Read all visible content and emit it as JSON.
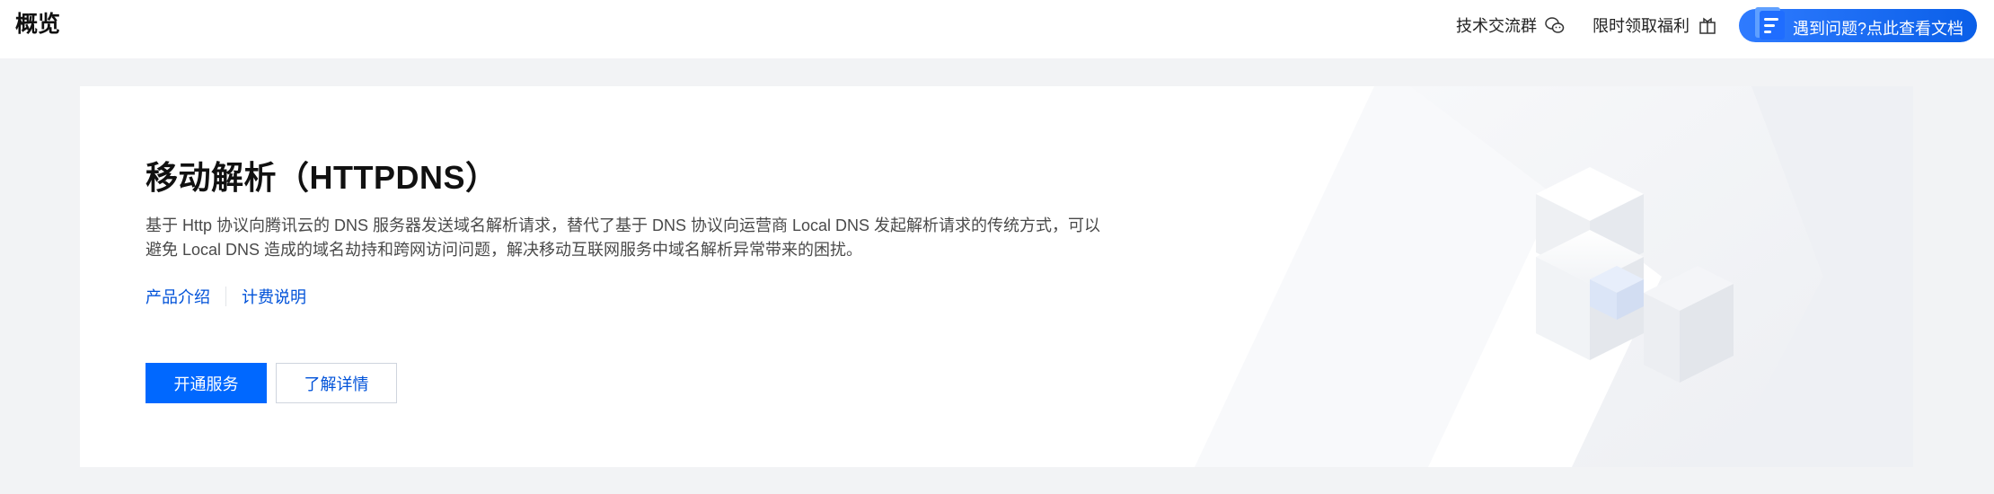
{
  "header": {
    "title": "概览",
    "links": [
      {
        "label": "技术交流群",
        "icon": "wechat-icon"
      },
      {
        "label": "限时领取福利",
        "icon": "gift-icon"
      }
    ],
    "help": {
      "label": "遇到问题?点此查看文档",
      "icon": "document-icon"
    }
  },
  "product": {
    "title": "移动解析（HTTPDNS）",
    "description": "基于 Http 协议向腾讯云的 DNS 服务器发送域名解析请求，替代了基于 DNS 协议向运营商 Local DNS 发起解析请求的传统方式，可以避免 Local DNS 造成的域名劫持和跨网访问问题，解决移动互联网服务中域名解析异常带来的困扰。",
    "links": [
      {
        "label": "产品介绍"
      },
      {
        "label": "计费说明"
      }
    ],
    "primary_button": "开通服务",
    "secondary_button": "了解详情"
  },
  "colors": {
    "accent": "#0068ff",
    "link": "#0052d9",
    "page_bg": "#f2f3f5"
  }
}
